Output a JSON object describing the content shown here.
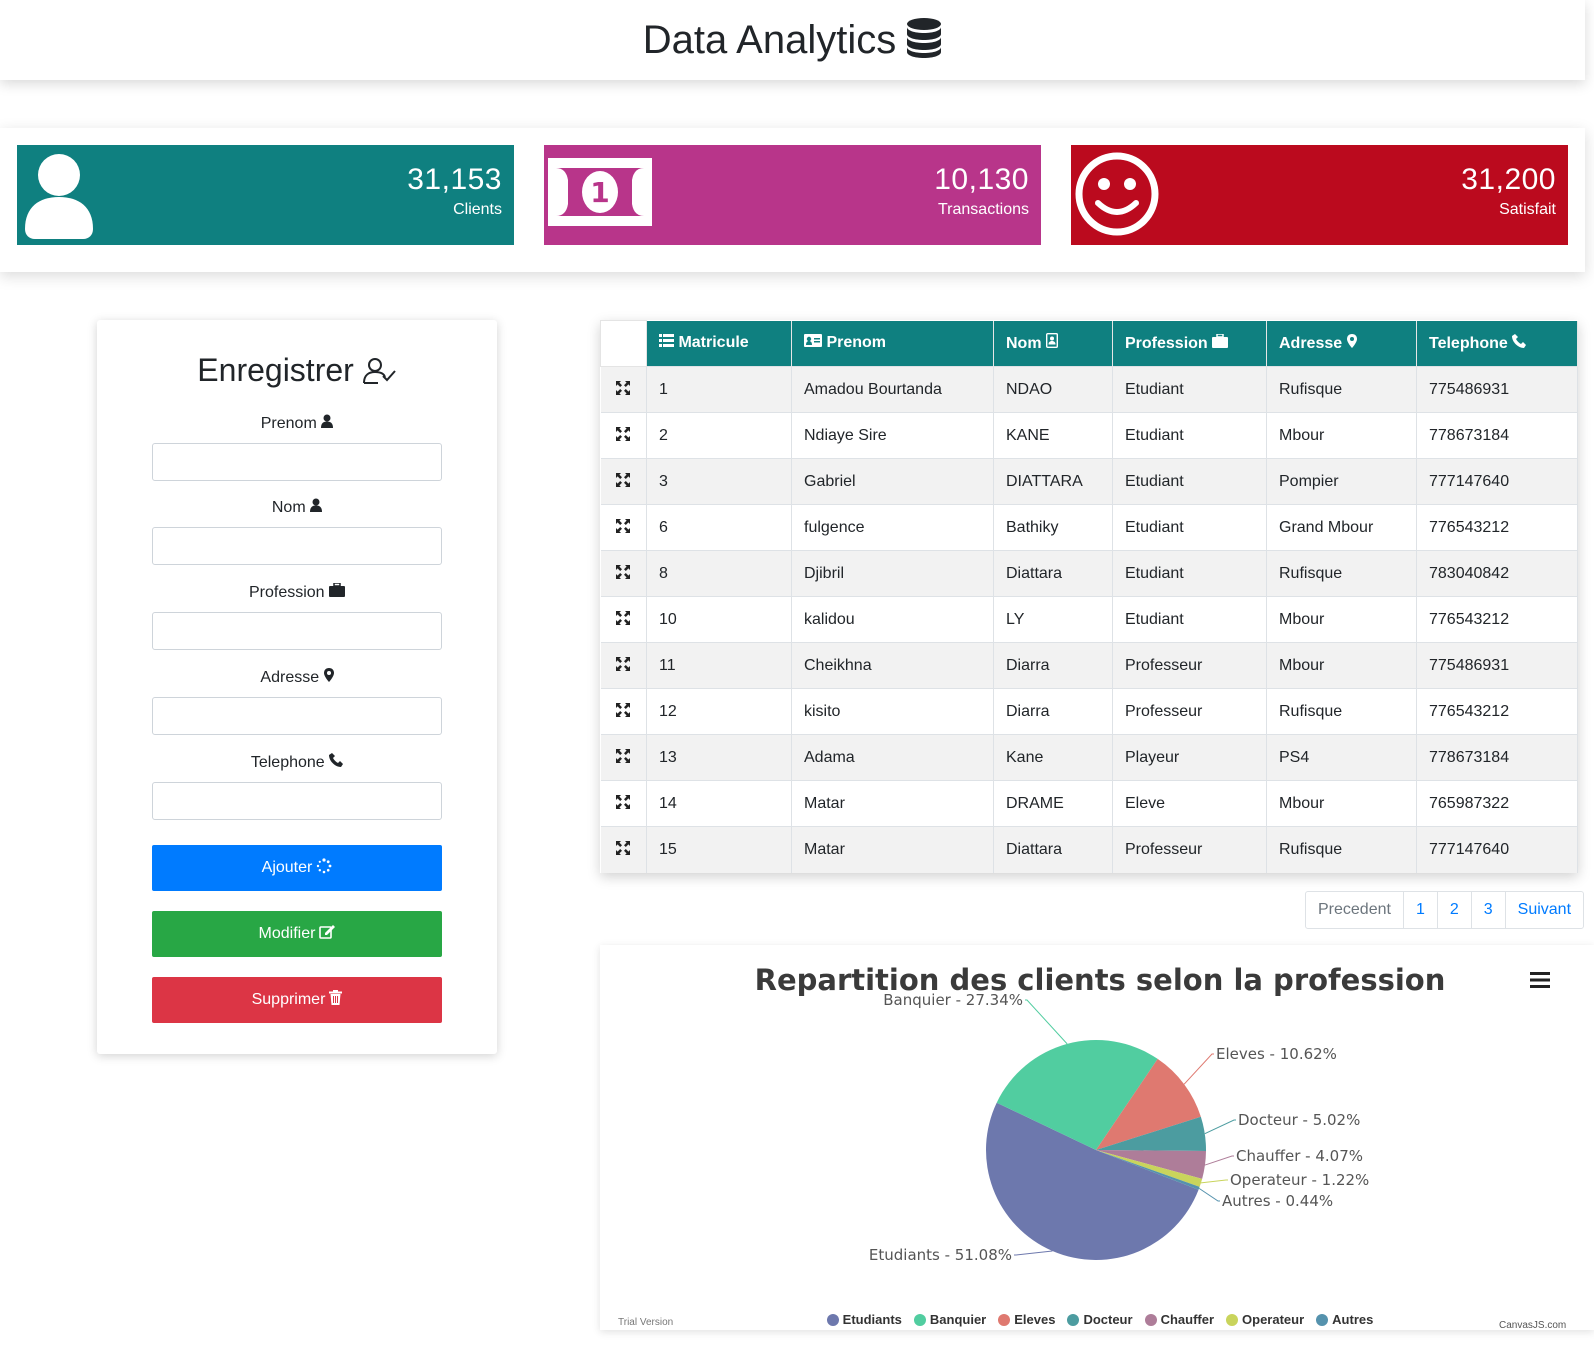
{
  "header": {
    "title": "Data Analytics",
    "icon": "database-icon"
  },
  "stats": [
    {
      "value": "31,153",
      "label": "Clients",
      "color": "#0f8080",
      "icon": "user-icon"
    },
    {
      "value": "10,130",
      "label": "Transactions",
      "color": "#b8358a",
      "icon": "money-bill-icon"
    },
    {
      "value": "31,200",
      "label": "Satisfait",
      "color": "#bb0a1e",
      "icon": "smile-icon"
    }
  ],
  "form": {
    "title": "Enregistrer",
    "fields": [
      {
        "label": "Prenom",
        "value": ""
      },
      {
        "label": "Nom",
        "value": ""
      },
      {
        "label": "Profession",
        "value": ""
      },
      {
        "label": "Adresse",
        "value": ""
      },
      {
        "label": "Telephone",
        "value": ""
      }
    ],
    "buttons": {
      "add": "Ajouter",
      "modify": "Modifier",
      "delete": "Supprimer"
    },
    "colors": {
      "add": "#007bff",
      "modify": "#28a745",
      "delete": "#dc3545"
    }
  },
  "table": {
    "headers": [
      "Matricule",
      "Prenom",
      "Nom",
      "Profession",
      "Adresse",
      "Telephone"
    ],
    "rows": [
      [
        "1",
        "Amadou Bourtanda",
        "NDAO",
        "Etudiant",
        "Rufisque",
        "775486931"
      ],
      [
        "2",
        "Ndiaye Sire",
        "KANE",
        "Etudiant",
        "Mbour",
        "778673184"
      ],
      [
        "3",
        "Gabriel",
        "DIATTARA",
        "Etudiant",
        "Pompier",
        "777147640"
      ],
      [
        "6",
        "fulgence",
        "Bathiky",
        "Etudiant",
        "Grand Mbour",
        "776543212"
      ],
      [
        "8",
        "Djibril",
        "Diattara",
        "Etudiant",
        "Rufisque",
        "783040842"
      ],
      [
        "10",
        "kalidou",
        "LY",
        "Etudiant",
        "Mbour",
        "776543212"
      ],
      [
        "11",
        "Cheikhna",
        "Diarra",
        "Professeur",
        "Mbour",
        "775486931"
      ],
      [
        "12",
        "kisito",
        "Diarra",
        "Professeur",
        "Rufisque",
        "776543212"
      ],
      [
        "13",
        "Adama",
        "Kane",
        "Playeur",
        "PS4",
        "778673184"
      ],
      [
        "14",
        "Matar",
        "DRAME",
        "Eleve",
        "Mbour",
        "765987322"
      ],
      [
        "15",
        "Matar",
        "Diattara",
        "Professeur",
        "Rufisque",
        "777147640"
      ]
    ]
  },
  "pagination": {
    "prev": "Precedent",
    "pages": [
      "1",
      "2",
      "3"
    ],
    "next": "Suivant"
  },
  "chart_footer": {
    "trial": "Trial Version",
    "credit": "CanvasJS.com"
  },
  "chart_data": {
    "type": "pie",
    "title": "Repartition des clients selon la profession",
    "slices": [
      {
        "name": "Etudiants",
        "value": 51.08,
        "label": "Etudiants - 51.08%",
        "color": "#6d78ad"
      },
      {
        "name": "Banquier",
        "value": 27.34,
        "label": "Banquier - 27.34%",
        "color": "#51cda0"
      },
      {
        "name": "Eleves",
        "value": 10.62,
        "label": "Eleves - 10.62%",
        "color": "#df7970"
      },
      {
        "name": "Docteur",
        "value": 5.02,
        "label": "Docteur - 5.02%",
        "color": "#4c9ca0"
      },
      {
        "name": "Chauffer",
        "value": 4.07,
        "label": "Chauffer - 4.07%",
        "color": "#ae7d99"
      },
      {
        "name": "Operateur",
        "value": 1.22,
        "label": "Operateur - 1.22%",
        "color": "#c9d45c"
      },
      {
        "name": "Autres",
        "value": 0.44,
        "label": "Autres - 0.44%",
        "color": "#5592ad"
      }
    ],
    "legend_position": "bottom"
  }
}
